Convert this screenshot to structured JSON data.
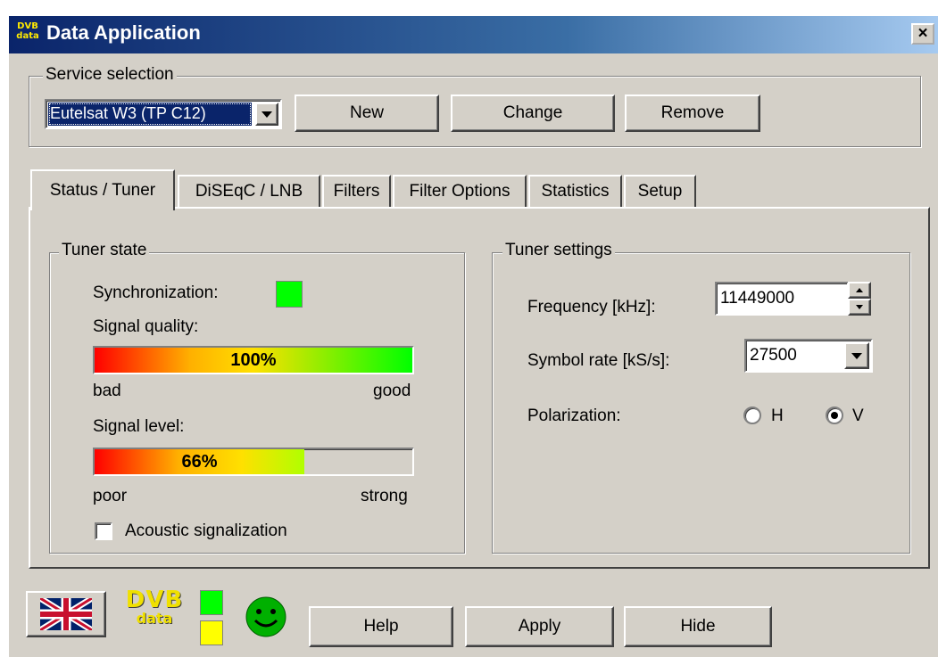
{
  "window": {
    "title": "Data Application",
    "app_icon_text": "DVB data",
    "close_glyph": "×"
  },
  "service": {
    "group_label": "Service selection",
    "selected": "Eutelsat W3 (TP C12)",
    "new_label": "New",
    "change_label": "Change",
    "remove_label": "Remove"
  },
  "tabs": [
    "Status / Tuner",
    "DiSEqC / LNB",
    "Filters",
    "Filter Options",
    "Statistics",
    "Setup"
  ],
  "tuner_state": {
    "group_label": "Tuner state",
    "sync_label": "Synchronization:",
    "quality_label": "Signal quality:",
    "quality_value": 1.0,
    "quality_text": "100%",
    "quality_low": "bad",
    "quality_high": "good",
    "level_label": "Signal level:",
    "level_value": 0.66,
    "level_text": "66%",
    "level_low": "poor",
    "level_high": "strong",
    "acoustic_label": "Acoustic signalization",
    "acoustic_checked": false
  },
  "tuner_settings": {
    "group_label": "Tuner settings",
    "frequency_label": "Frequency [kHz]:",
    "frequency_value": "11449000",
    "symbol_label": "Symbol rate [kS/s]:",
    "symbol_value": "27500",
    "polarization_label": "Polarization:",
    "pol_h": "H",
    "pol_v": "V",
    "pol_selected": "V"
  },
  "footer": {
    "logo_text_top": "DVB",
    "logo_text_bottom": "data",
    "help_label": "Help",
    "apply_label": "Apply",
    "hide_label": "Hide"
  },
  "colors": {
    "sync_led": "#00ff00",
    "status_green": "#00ff00",
    "status_yellow": "#ffff00",
    "smiley": "#00c000"
  }
}
